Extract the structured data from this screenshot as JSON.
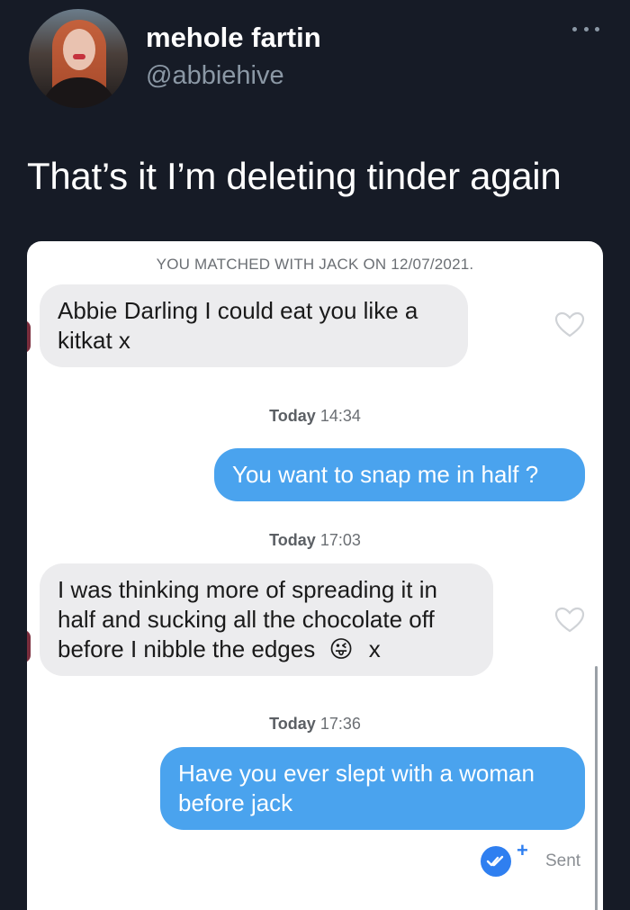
{
  "tweet": {
    "display_name": "mehole fartin",
    "handle": "@abbiehive",
    "text": "That’s it I’m deleting tinder again",
    "more_icon": "more-dots-icon"
  },
  "chat": {
    "match_notice": "YOU MATCHED WITH JACK ON 12/07/2021.",
    "messages": [
      {
        "type": "received",
        "lines": [
          "Abbie Darling I could eat you like a",
          "kitkat x"
        ]
      },
      {
        "type": "timestamp",
        "day": "Today",
        "time": "14:34"
      },
      {
        "type": "sent",
        "lines": [
          "You want to snap me in half ?"
        ]
      },
      {
        "type": "timestamp",
        "day": "Today",
        "time": "17:03"
      },
      {
        "type": "received",
        "lines": [
          "I was thinking more of spreading it in",
          "half and sucking all the chocolate off",
          "before I nibble the edges"
        ],
        "emoji": "😜",
        "suffix": "x"
      },
      {
        "type": "timestamp",
        "day": "Today",
        "time": "17:36"
      },
      {
        "type": "sent",
        "lines": [
          "Have you ever slept with a woman",
          "before jack"
        ]
      }
    ],
    "status": {
      "label": "Sent",
      "plus": "+"
    },
    "colors": {
      "sent_bubble": "#4aa3ee",
      "received_bubble": "#ececee",
      "background": "#161b26"
    }
  }
}
